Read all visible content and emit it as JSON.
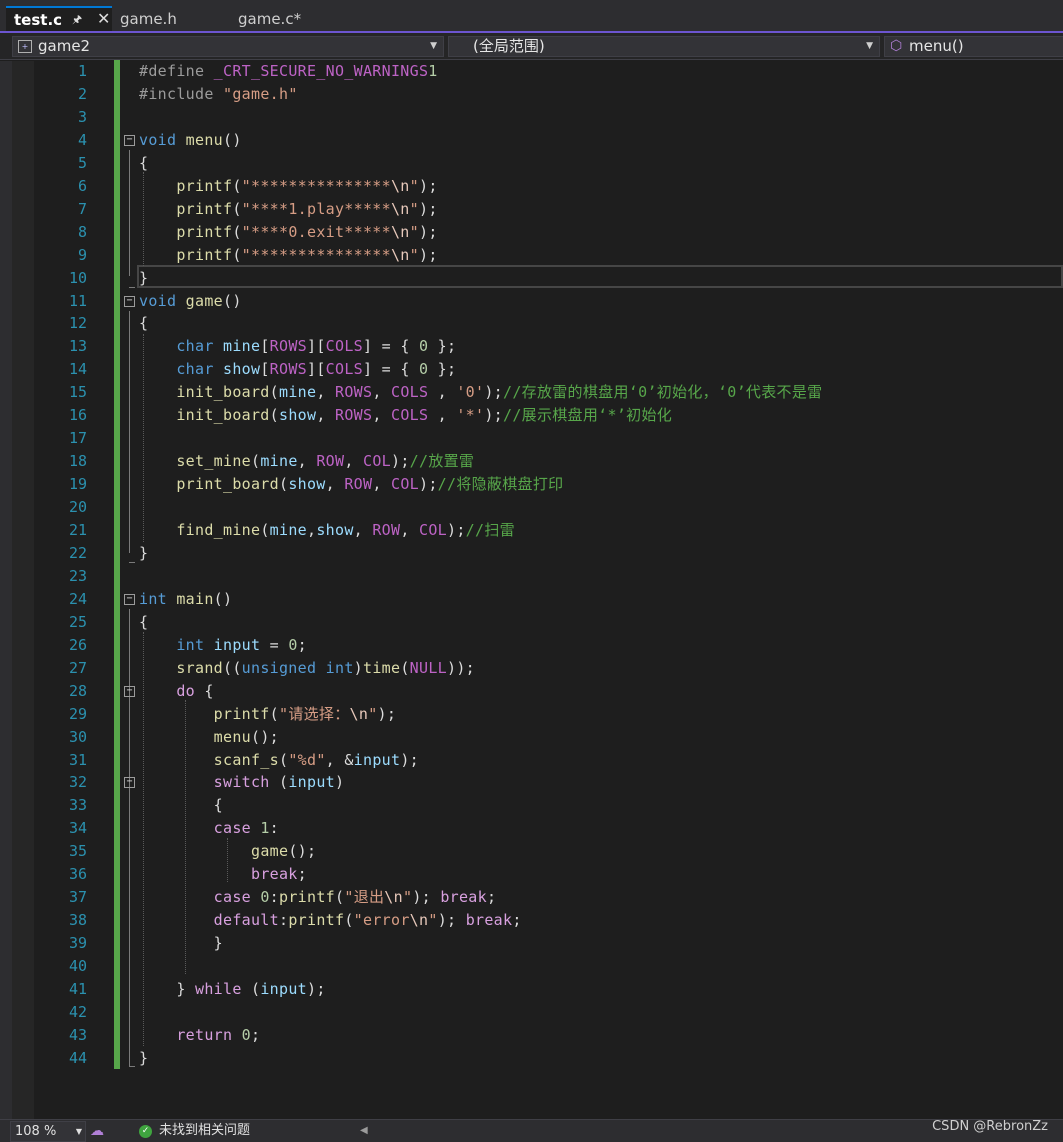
{
  "tabs": [
    {
      "label": "test.c",
      "active": true
    },
    {
      "label": "game.h",
      "active": false
    },
    {
      "label": "game.c*",
      "active": false
    }
  ],
  "tab_icons": {
    "pin": "pin-icon",
    "close": "close-icon"
  },
  "navbar": {
    "project": "game2",
    "scope": "(全局范围)",
    "member": "menu()"
  },
  "colors": {
    "accent": "#6c55d0",
    "keyword": "#569cd6",
    "string": "#d69d85",
    "comment": "#57a64a",
    "line_number": "#2b91af",
    "change_bar": "#57a64a"
  },
  "editor": {
    "language": "C",
    "current_line": 10,
    "lines": [
      {
        "n": "1",
        "html": "<span class='pp'>#define</span> <span class='mac'>_CRT_SECURE_NO_WARNINGS</span><span class='num'>1</span>"
      },
      {
        "n": "2",
        "html": "<span class='pp'>#include</span> <span class='str'>\"game.h\"</span>"
      },
      {
        "n": "3",
        "html": ""
      },
      {
        "n": "4",
        "html": "<span class='kw'>void</span> <span class='fn'>menu</span>()",
        "fold": true
      },
      {
        "n": "5",
        "html": "{"
      },
      {
        "n": "6",
        "html": "    <span class='fn'>printf</span>(<span class='str'>\"***************</span><span class='esc'>\\n</span><span class='str'>\"</span>);"
      },
      {
        "n": "7",
        "html": "    <span class='fn'>printf</span>(<span class='str'>\"****1.play*****</span><span class='esc'>\\n</span><span class='str'>\"</span>);"
      },
      {
        "n": "8",
        "html": "    <span class='fn'>printf</span>(<span class='str'>\"****0.exit*****</span><span class='esc'>\\n</span><span class='str'>\"</span>);"
      },
      {
        "n": "9",
        "html": "    <span class='fn'>printf</span>(<span class='str'>\"***************</span><span class='esc'>\\n</span><span class='str'>\"</span>);"
      },
      {
        "n": "10",
        "html": "}"
      },
      {
        "n": "11",
        "html": "<span class='kw'>void</span> <span class='fn'>game</span>()",
        "fold": true
      },
      {
        "n": "12",
        "html": "{"
      },
      {
        "n": "13",
        "html": "    <span class='kw'>char</span> <span class='var'>mine</span>[<span class='mac'>ROWS</span>][<span class='mac'>COLS</span>] = { <span class='num'>0</span> };"
      },
      {
        "n": "14",
        "html": "    <span class='kw'>char</span> <span class='var'>show</span>[<span class='mac'>ROWS</span>][<span class='mac'>COLS</span>] = { <span class='num'>0</span> };"
      },
      {
        "n": "15",
        "html": "    <span class='fn'>init_board</span>(<span class='var'>mine</span>, <span class='mac'>ROWS</span>, <span class='mac'>COLS</span> , <span class='str'>'0'</span>);<span class='cmt'>//存放雷的棋盘用‘0’初始化，‘0’代表不是雷</span>"
      },
      {
        "n": "16",
        "html": "    <span class='fn'>init_board</span>(<span class='var'>show</span>, <span class='mac'>ROWS</span>, <span class='mac'>COLS</span> , <span class='str'>'*'</span>);<span class='cmt'>//展示棋盘用‘*’初始化</span>"
      },
      {
        "n": "17",
        "html": ""
      },
      {
        "n": "18",
        "html": "    <span class='fn'>set_mine</span>(<span class='var'>mine</span>, <span class='mac'>ROW</span>, <span class='mac'>COL</span>);<span class='cmt'>//放置雷</span>"
      },
      {
        "n": "19",
        "html": "    <span class='fn'>print_board</span>(<span class='var'>show</span>, <span class='mac'>ROW</span>, <span class='mac'>COL</span>);<span class='cmt'>//将隐蔽棋盘打印</span>"
      },
      {
        "n": "20",
        "html": ""
      },
      {
        "n": "21",
        "html": "    <span class='fn'>find_mine</span>(<span class='var'>mine</span>,<span class='var'>show</span>, <span class='mac'>ROW</span>, <span class='mac'>COL</span>);<span class='cmt'>//扫雷</span>"
      },
      {
        "n": "22",
        "html": "}"
      },
      {
        "n": "23",
        "html": ""
      },
      {
        "n": "24",
        "html": "<span class='kw'>int</span> <span class='fn'>main</span>()",
        "fold": true
      },
      {
        "n": "25",
        "html": "{"
      },
      {
        "n": "26",
        "html": "    <span class='kw'>int</span> <span class='var'>input</span> = <span class='num'>0</span>;"
      },
      {
        "n": "27",
        "html": "    <span class='fn'>srand</span>((<span class='kw'>unsigned</span> <span class='kw'>int</span>)<span class='fn'>time</span>(<span class='mac'>NULL</span>));"
      },
      {
        "n": "28",
        "html": "    <span class='ctl'>do</span> {",
        "fold": true
      },
      {
        "n": "29",
        "html": "        <span class='fn'>printf</span>(<span class='str'>\"请选择：</span><span class='esc'>\\n</span><span class='str'>\"</span>);"
      },
      {
        "n": "30",
        "html": "        <span class='fn'>menu</span>();"
      },
      {
        "n": "31",
        "html": "        <span class='fn'>scanf_s</span>(<span class='str'>\"%d\"</span>, &amp;<span class='var'>input</span>);"
      },
      {
        "n": "32",
        "html": "        <span class='ctl'>switch</span> (<span class='var'>input</span>)",
        "fold": true
      },
      {
        "n": "33",
        "html": "        {"
      },
      {
        "n": "34",
        "html": "        <span class='ctl'>case</span> <span class='num'>1</span>:"
      },
      {
        "n": "35",
        "html": "            <span class='fn'>game</span>();"
      },
      {
        "n": "36",
        "html": "            <span class='ctl'>break</span>;"
      },
      {
        "n": "37",
        "html": "        <span class='ctl'>case</span> <span class='num'>0</span>:<span class='fn'>printf</span>(<span class='str'>\"退出</span><span class='esc'>\\n</span><span class='str'>\"</span>); <span class='ctl'>break</span>;"
      },
      {
        "n": "38",
        "html": "        <span class='ctl'>default</span>:<span class='fn'>printf</span>(<span class='str'>\"error</span><span class='esc'>\\n</span><span class='str'>\"</span>); <span class='ctl'>break</span>;"
      },
      {
        "n": "39",
        "html": "        }"
      },
      {
        "n": "40",
        "html": ""
      },
      {
        "n": "41",
        "html": "    } <span class='ctl'>while</span> (<span class='var'>input</span>);"
      },
      {
        "n": "42",
        "html": ""
      },
      {
        "n": "43",
        "html": "    <span class='ctl'>return</span> <span class='num'>0</span>;"
      },
      {
        "n": "44",
        "html": "}"
      }
    ]
  },
  "statusbar": {
    "zoom": "108 %",
    "issues": "未找到相关问题",
    "zoom_icon": "chevron-down-icon",
    "intellicode_icon": "brain-icon",
    "status_icon": "check-circle-icon"
  },
  "watermark": "CSDN @RebronZz"
}
